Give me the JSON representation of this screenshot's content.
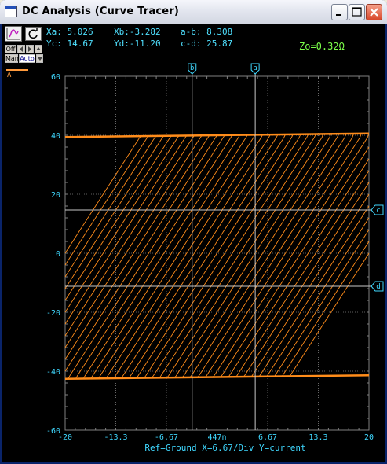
{
  "window": {
    "title": "DC Analysis (Curve Tracer)"
  },
  "toolbar": {
    "off_label": "Off",
    "man_label": "Man",
    "auto_label": "Auto"
  },
  "readouts": {
    "xa": "Xa: 5.026",
    "xb": "Xb:-3.282",
    "a_minus_b": "a-b: 8.308",
    "yc": "Yc: 14.67",
    "yd": "Yd:-11.20",
    "c_minus_d": "c-d: 25.87",
    "zo": "Zo=0.32Ω"
  },
  "legend": {
    "label": "A",
    "color": "#ff9a3c"
  },
  "cursors": {
    "a_label": "a",
    "b_label": "b",
    "c_label": "c",
    "d_label": "d"
  },
  "axis": {
    "footer": "Ref=Ground  X=6.67/Div Y=current"
  },
  "colors": {
    "trace": "#ff8c1a",
    "axis_text": "#3fd8ff",
    "grid": "#808080",
    "background": "#000000"
  },
  "chart_data": {
    "type": "line",
    "xlim": [
      -20,
      20
    ],
    "ylim": [
      -60,
      60
    ],
    "x_tick_labels": [
      "-20",
      "-13.3",
      "-6.67",
      "447n",
      "6.67",
      "13.3",
      "20"
    ],
    "x_tick_values": [
      -20,
      -13.33,
      -6.67,
      0,
      6.67,
      13.33,
      20
    ],
    "y_tick_labels": [
      "60",
      "40",
      "20",
      "0",
      "-20",
      "-40",
      "-60"
    ],
    "y_tick_values": [
      60,
      40,
      20,
      0,
      -20,
      -40,
      -60
    ],
    "grid": true,
    "curve_family": {
      "description_from_plot": "family of limiting transfer curves",
      "count": 41,
      "offset_range": [
        -20,
        20
      ],
      "saturation_low": -42,
      "saturation_high": 40,
      "slope": 4
    },
    "cursors": {
      "xa": 5.026,
      "xb": -3.282,
      "yc": 14.67,
      "yd": -11.2
    }
  }
}
